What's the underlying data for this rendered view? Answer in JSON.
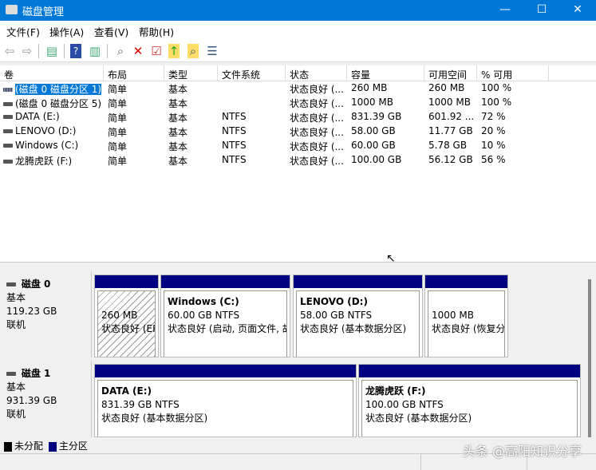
{
  "window": {
    "title": "磁盘管理",
    "minimize": "—",
    "maximize": "☐",
    "close": "✕"
  },
  "menu": [
    "文件(F)",
    "操作(A)",
    "查看(V)",
    "帮助(H)"
  ],
  "columns": [
    "卷",
    "布局",
    "类型",
    "文件系统",
    "状态",
    "容量",
    "可用空间",
    "% 可用"
  ],
  "volumes": [
    {
      "name": "(磁盘 0 磁盘分区 1)",
      "layout": "简单",
      "type": "基本",
      "fs": "",
      "status": "状态良好 (...",
      "capacity": "260 MB",
      "free": "260 MB",
      "pct": "100 %"
    },
    {
      "name": "(磁盘 0 磁盘分区 5)",
      "layout": "简单",
      "type": "基本",
      "fs": "",
      "status": "状态良好 (...",
      "capacity": "1000 MB",
      "free": "1000 MB",
      "pct": "100 %"
    },
    {
      "name": "DATA (E:)",
      "layout": "简单",
      "type": "基本",
      "fs": "NTFS",
      "status": "状态良好 (...",
      "capacity": "831.39 GB",
      "free": "601.92 ...",
      "pct": "72 %"
    },
    {
      "name": "LENOVO (D:)",
      "layout": "简单",
      "type": "基本",
      "fs": "NTFS",
      "status": "状态良好 (...",
      "capacity": "58.00 GB",
      "free": "11.77 GB",
      "pct": "20 %"
    },
    {
      "name": "Windows (C:)",
      "layout": "简单",
      "type": "基本",
      "fs": "NTFS",
      "status": "状态良好 (...",
      "capacity": "60.00 GB",
      "free": "5.78 GB",
      "pct": "10 %"
    },
    {
      "name": "龙腾虎跃 (F:)",
      "layout": "简单",
      "type": "基本",
      "fs": "NTFS",
      "status": "状态良好 (...",
      "capacity": "100.00 GB",
      "free": "56.12 GB",
      "pct": "56 %"
    }
  ],
  "disks": [
    {
      "name": "磁盘 0",
      "type": "基本",
      "size": "119.23 GB",
      "state": "联机",
      "parts": [
        {
          "title": "",
          "size": "260 MB",
          "status": "状态良好 (EFI"
        },
        {
          "title": "Windows  (C:)",
          "size": "60.00 GB NTFS",
          "status": "状态良好 (启动, 页面文件, 故"
        },
        {
          "title": "LENOVO  (D:)",
          "size": "58.00 GB NTFS",
          "status": "状态良好 (基本数据分区)"
        },
        {
          "title": "",
          "size": "1000 MB",
          "status": "状态良好 (恢复分"
        }
      ]
    },
    {
      "name": "磁盘 1",
      "type": "基本",
      "size": "931.39 GB",
      "state": "联机",
      "parts": [
        {
          "title": "DATA  (E:)",
          "size": "831.39 GB NTFS",
          "status": "状态良好 (基本数据分区)"
        },
        {
          "title": "龙腾虎跃  (F:)",
          "size": "100.00 GB NTFS",
          "status": "状态良好 (基本数据分区)"
        }
      ]
    }
  ],
  "legend": {
    "unallocated": "未分配",
    "primary": "主分区",
    "unallocated_color": "#000000",
    "primary_color": "#000080"
  },
  "watermark": "头条 @高阳知识分享"
}
